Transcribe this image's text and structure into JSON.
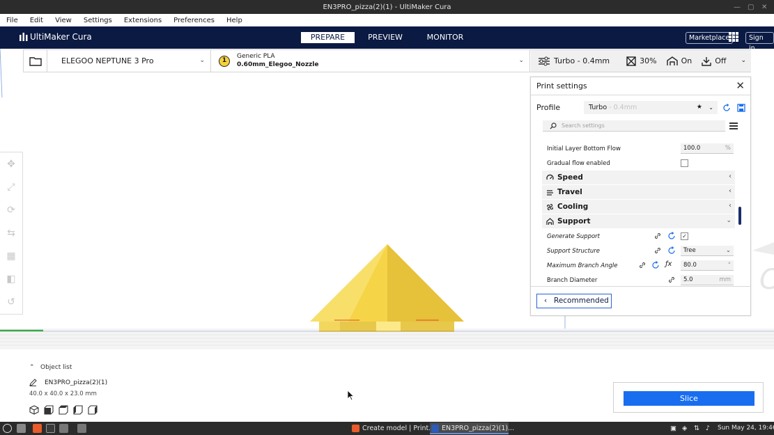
{
  "window": {
    "title": "EN3PRO_pizza(2)(1) - UltiMaker Cura"
  },
  "menu": [
    "File",
    "Edit",
    "View",
    "Settings",
    "Extensions",
    "Preferences",
    "Help"
  ],
  "header": {
    "brand": "UltiMaker Cura",
    "tabs": [
      "PREPARE",
      "PREVIEW",
      "MONITOR"
    ],
    "active_tab": "PREPARE",
    "marketplace_label": "Marketplace",
    "signin_label": "Sign in"
  },
  "stage": {
    "machine": "ELEGOO NEPTUNE 3 Pro",
    "material_badge": "1",
    "material_name": "Generic PLA",
    "nozzle": "0.60mm_Elegoo_Nozzle",
    "quick": {
      "profile": "Turbo - 0.4mm",
      "infill": "30%",
      "support": "On",
      "adhesion": "Off"
    }
  },
  "print_settings": {
    "title": "Print settings",
    "profile_label": "Profile",
    "profile_name": "Turbo",
    "profile_suffix": " - 0.4mm",
    "search_placeholder": "Search settings",
    "rows": {
      "initial_layer_bottom_flow": {
        "label": "Initial Layer Bottom Flow",
        "value": "100.0",
        "unit": "%"
      },
      "gradual_flow": {
        "label": "Gradual flow enabled",
        "checked": false
      },
      "generate_support": {
        "label": "Generate Support",
        "checked": true
      },
      "support_structure": {
        "label": "Support Structure",
        "value": "Tree"
      },
      "max_branch_angle": {
        "label": "Maximum Branch Angle",
        "value": "80.0",
        "unit": "°"
      },
      "branch_diameter": {
        "label": "Branch Diameter",
        "value": "5.0",
        "unit": "mm"
      }
    },
    "categories": {
      "speed": "Speed",
      "travel": "Travel",
      "cooling": "Cooling",
      "support": "Support"
    },
    "recommended_label": "Recommended"
  },
  "objects": {
    "list_label": "Object list",
    "name": "EN3PRO_pizza(2)(1)",
    "dimensions": "40.0 x 40.0 x 23.0 mm"
  },
  "slice_label": "Slice",
  "taskbar": {
    "tasks": [
      "Create model | Print...",
      "EN3PRO_pizza(2)(1)..."
    ],
    "clock": "Sun May 24, 19:46"
  },
  "colors": {
    "header_bg": "#0b1a43",
    "accent_blue": "#196ef0",
    "model_yellow": "#f5d547",
    "scrollbar": "#1a2d6b"
  }
}
